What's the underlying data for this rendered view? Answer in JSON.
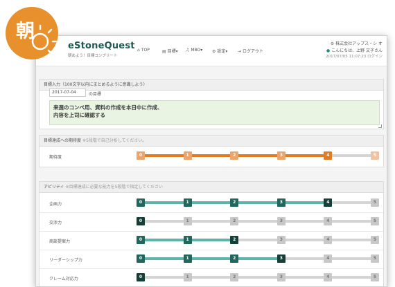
{
  "app": {
    "logo_title": "eStoneQuest",
    "logo_sub": "朝あよう！目標コンプリート"
  },
  "nav": [
    {
      "icon": "home-icon",
      "glyph": "⌂",
      "label": "TOP"
    },
    {
      "icon": "document-icon",
      "glyph": "▤",
      "label": "目標▾"
    },
    {
      "icon": "headset-icon",
      "glyph": "♫",
      "label": "MBO▾"
    },
    {
      "icon": "gear-icon",
      "glyph": "⚙",
      "label": "設定▾"
    },
    {
      "icon": "logout-icon",
      "glyph": "⇥",
      "label": "ログアウト"
    }
  ],
  "header": {
    "company": "株式会社アップス・シ オ",
    "greeting": "こんにちは、上野 文子さん",
    "last_login": "2017/07/05 11:07:23 ログイン"
  },
  "badge": {
    "char": "朝",
    "color": "#e8902c"
  },
  "goal": {
    "header": "目標入力（100文字以内にまとめるように意識しよう）",
    "date": "2017-07-04",
    "date_suffix": "の目標",
    "text": "来週のコンペ用、資料の作成を本日中に作成、\n内容を上司に確認する"
  },
  "achievement": {
    "header": "目標達成への期待度",
    "header_note": "※5段階で自己分析してください。",
    "rows": [
      {
        "label": "期待度",
        "value": 4
      }
    ],
    "colors": {
      "fill": "#e57b20",
      "done": "#eca46a",
      "current": "#e57b20",
      "todo": "#f0c3a2"
    }
  },
  "ability": {
    "header": "アビリティ",
    "header_note": "※目標達成に必要な能力を5段階で指定してください",
    "rows": [
      {
        "label": "企画力",
        "value": 4
      },
      {
        "label": "交渉力",
        "value": 0
      },
      {
        "label": "商談提案力",
        "value": 2
      },
      {
        "label": "リーダーシップ力",
        "value": 3
      },
      {
        "label": "クレーム対応力",
        "value": 0
      }
    ],
    "colors": {
      "fill": "#5fb4aa",
      "done": "#22675e",
      "current": "#153f39",
      "todo": "#c8c8c8",
      "todo_text": "#777777"
    }
  },
  "scale": [
    "0",
    "1",
    "2",
    "3",
    "4",
    "5"
  ]
}
